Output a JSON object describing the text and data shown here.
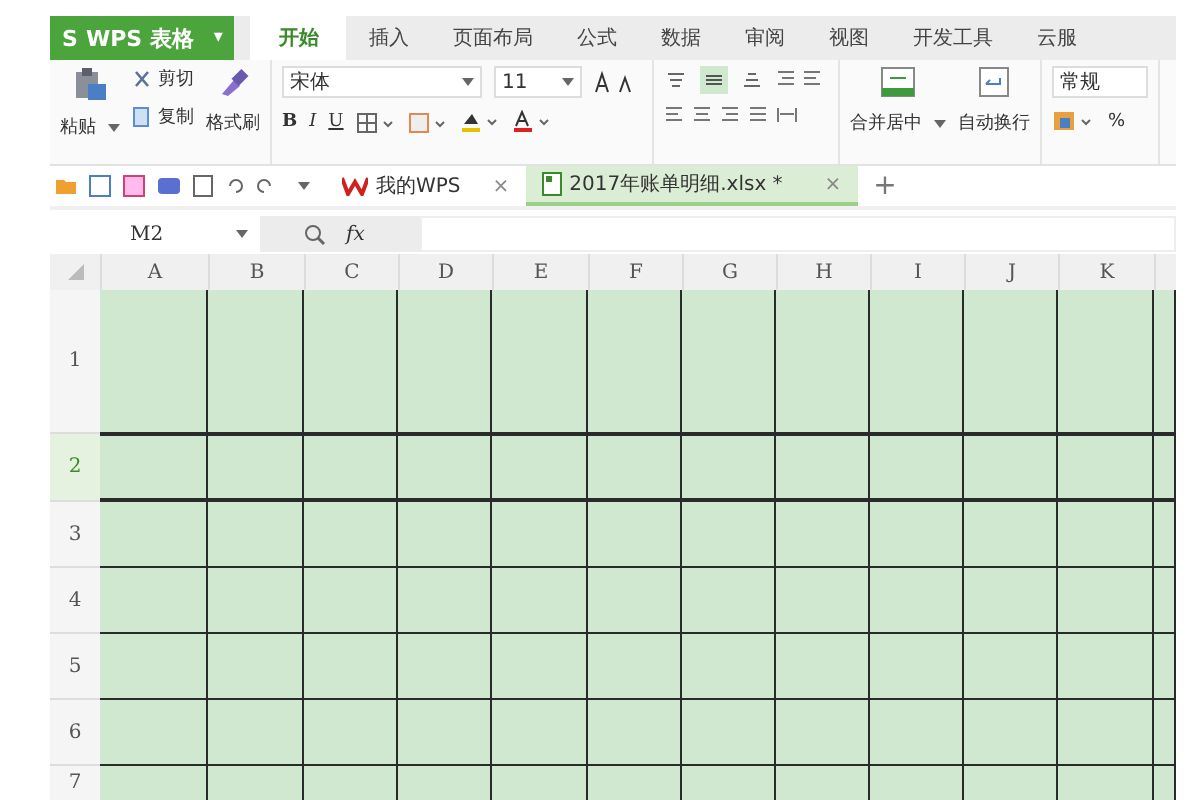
{
  "app_menu": {
    "logo": "S",
    "title": "WPS 表格",
    "caret": "▾"
  },
  "ribbon_tabs": [
    {
      "label": "开始",
      "selected": true
    },
    {
      "label": "插入",
      "selected": false
    },
    {
      "label": "页面布局",
      "selected": false
    },
    {
      "label": "公式",
      "selected": false
    },
    {
      "label": "数据",
      "selected": false
    },
    {
      "label": "审阅",
      "selected": false
    },
    {
      "label": "视图",
      "selected": false
    },
    {
      "label": "开发工具",
      "selected": false
    },
    {
      "label": "云服",
      "selected": false
    }
  ],
  "clipboard": {
    "paste": "粘贴",
    "cut": "剪切",
    "copy": "复制",
    "format_painter": "格式刷"
  },
  "font": {
    "name": "宋体",
    "size": "11"
  },
  "format_buttons": [
    "B",
    "I",
    "U"
  ],
  "merge": {
    "merge_center": "合并居中",
    "wrap_text": "自动换行"
  },
  "number": {
    "format": "常规",
    "percent": "%"
  },
  "doc_tabs": [
    {
      "label": "我的WPS",
      "selected": false
    },
    {
      "label": "2017年账单明细.xlsx *",
      "selected": true
    }
  ],
  "doc_tab_close": "×",
  "new_tab": "+",
  "formula_bar": {
    "name_box": "M2",
    "fx": "fx"
  },
  "columns": [
    "A",
    "B",
    "C",
    "D",
    "E",
    "F",
    "G",
    "H",
    "I",
    "J",
    "K"
  ],
  "rows": [
    {
      "label": "1",
      "selected": false
    },
    {
      "label": "2",
      "selected": true
    },
    {
      "label": "3",
      "selected": false
    },
    {
      "label": "4",
      "selected": false
    },
    {
      "label": "5",
      "selected": false
    },
    {
      "label": "6",
      "selected": false
    },
    {
      "label": "7",
      "selected": false
    }
  ]
}
